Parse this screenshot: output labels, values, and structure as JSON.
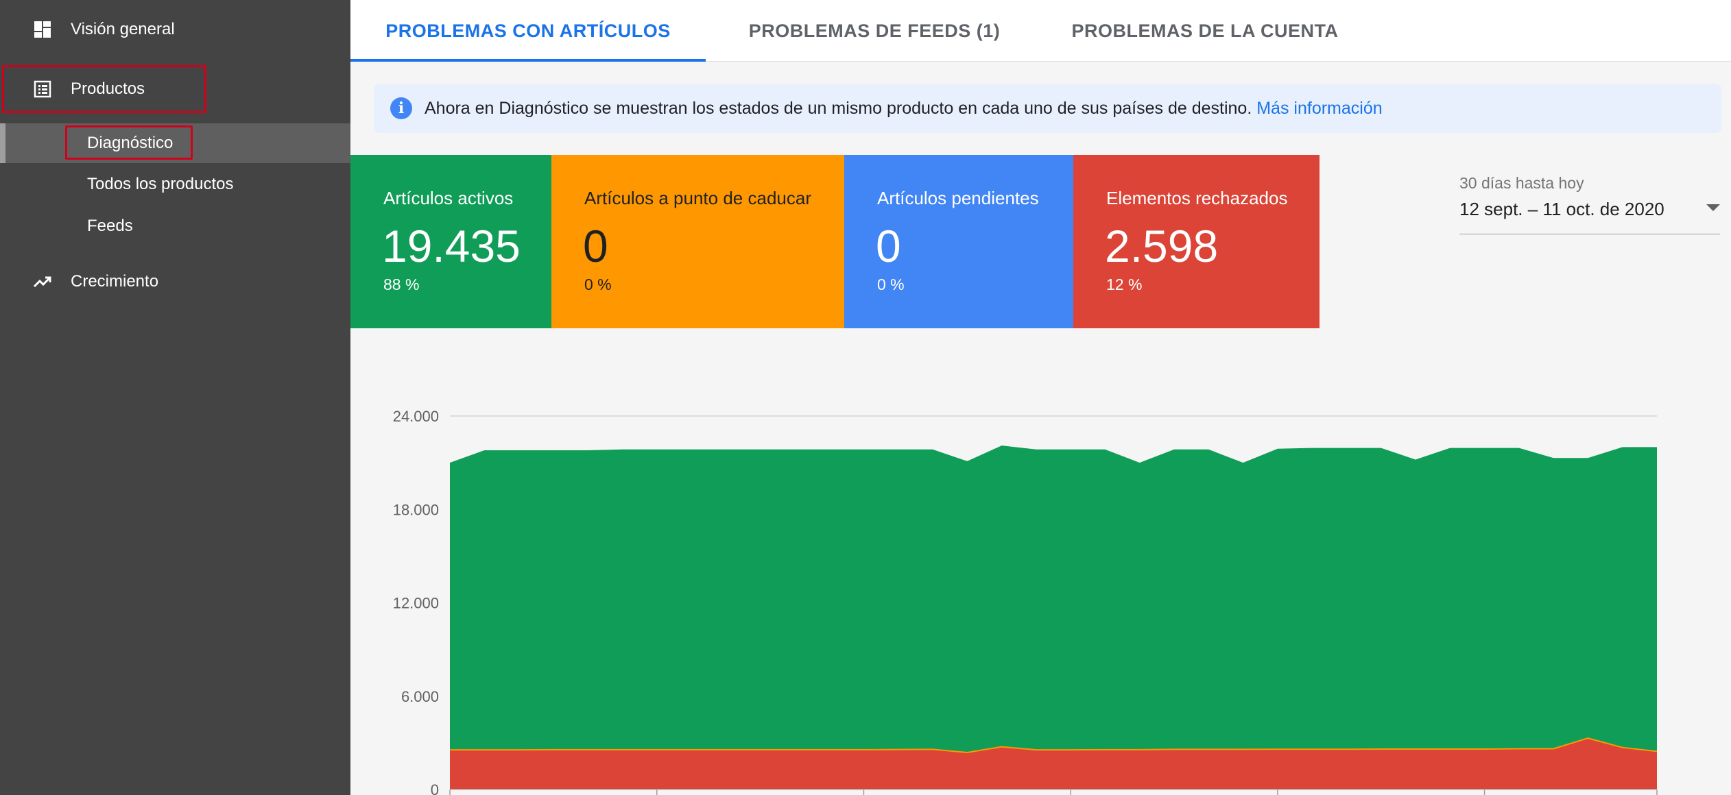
{
  "sidebar": {
    "items": [
      {
        "label": "Visión general",
        "icon": "dashboard-icon"
      },
      {
        "label": "Productos",
        "icon": "list-icon"
      },
      {
        "label": "Crecimiento",
        "icon": "trending-up-icon"
      }
    ],
    "sub_items": [
      {
        "label": "Diagnóstico"
      },
      {
        "label": "Todos los productos"
      },
      {
        "label": "Feeds"
      }
    ]
  },
  "tabs": [
    {
      "label": "PROBLEMAS CON ARTÍCULOS"
    },
    {
      "label": "PROBLEMAS DE FEEDS (1)"
    },
    {
      "label": "PROBLEMAS DE LA CUENTA"
    }
  ],
  "banner": {
    "icon": "info-icon",
    "icon_glyph": "i",
    "text": "Ahora en Diagnóstico se muestran los estados de un mismo producto en cada uno de sus países de destino. ",
    "link": "Más información"
  },
  "cards": [
    {
      "title": "Artículos activos",
      "value": "19.435",
      "percent": "88 %",
      "color": "#0f9d58"
    },
    {
      "title": "Artículos a punto de caducar",
      "value": "0",
      "percent": "0 %",
      "color": "#ff9800"
    },
    {
      "title": "Artículos pendientes",
      "value": "0",
      "percent": "0 %",
      "color": "#4285f4"
    },
    {
      "title": "Elementos rechazados",
      "value": "2.598",
      "percent": "12 %",
      "color": "#db4437"
    }
  ],
  "date_range": {
    "label": "30 días hasta hoy",
    "value": "12 sept. – 11 oct. de 2020"
  },
  "chart_data": {
    "type": "area",
    "y_ticks": [
      "24.000",
      "18.000",
      "12.000",
      "6.000",
      "0"
    ],
    "ylim": [
      0,
      24000
    ],
    "stacked": true,
    "colors": {
      "active": "#0f9d58",
      "expiring": "#ff9800",
      "rejected": "#db4437"
    },
    "series": [
      {
        "values": [
          21000,
          21800,
          21800,
          21800,
          21800,
          21850,
          21850,
          21850,
          21850,
          21850,
          21850,
          21850,
          21850,
          21850,
          21850,
          21100,
          22100,
          21850,
          21850,
          21850,
          21000,
          21850,
          21850,
          21000,
          21900,
          21950,
          21950,
          21950,
          21200,
          21950,
          21950,
          21950,
          21300,
          21300,
          22000,
          22000
        ]
      },
      {
        "values": [
          2550,
          2550,
          2550,
          2560,
          2560,
          2560,
          2560,
          2560,
          2560,
          2560,
          2560,
          2560,
          2560,
          2570,
          2580,
          2380,
          2750,
          2550,
          2550,
          2560,
          2560,
          2580,
          2580,
          2580,
          2590,
          2590,
          2590,
          2600,
          2600,
          2600,
          2600,
          2620,
          2620,
          3300,
          2700,
          2450
        ]
      }
    ]
  }
}
